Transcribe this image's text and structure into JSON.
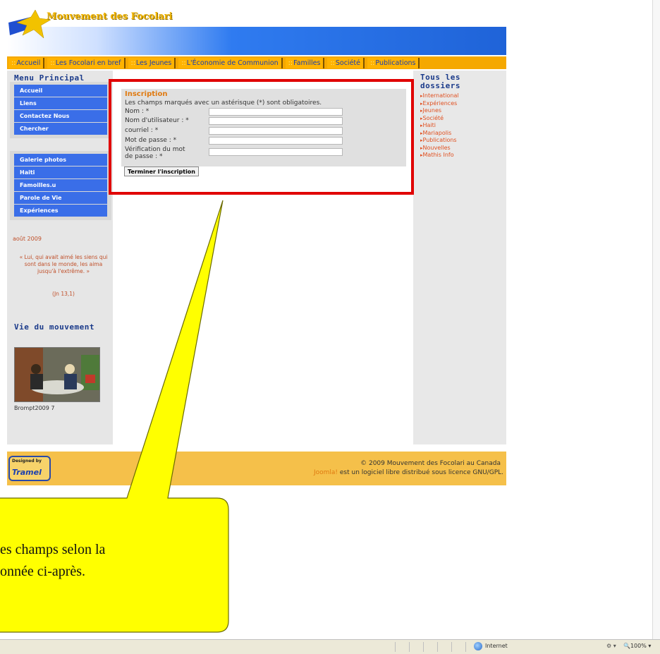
{
  "header": {
    "site_title": "Mouvement des Focolari"
  },
  "nav": [
    "Accueil",
    "Les Focolari en bref",
    "Les Jeunes",
    "L'Économie de Communion",
    "Familles",
    "Société",
    "Publications"
  ],
  "left": {
    "menu_title": "Menu Principal",
    "menu1": [
      "Accueil",
      "Liens",
      "Contactez Nous",
      "Chercher"
    ],
    "menu2": [
      "Galerie photos",
      "Haiti",
      "Famoilles.u",
      "Parole de Vie",
      "Expériences"
    ],
    "date": "août 2009",
    "quote": "« Lui, qui avait aimé les siens qui sont dans le monde, les aima jusqu'à l'extrême. »",
    "quote_ref": "(Jn 13,1)",
    "vie_title": "Vie du mouvement",
    "photo_caption": "Brompt2009 7"
  },
  "form": {
    "title": "Inscription",
    "note": "Les champs marqués avec un astérisque (*) sont obligatoires.",
    "labels": [
      "Nom : *",
      "Nom d'utilisateur : *",
      "courriel : *",
      "Mot de passe : *",
      "Vérification du mot",
      "de passe : *"
    ],
    "submit": "Terminer l'inscription"
  },
  "right": {
    "title": "Tous les dossiers",
    "items": [
      "International",
      "Expériences",
      "Jeunes",
      "Société",
      "Haiti",
      "Mariapolis",
      "Publications",
      "Nouvelles",
      "Mathis Info"
    ]
  },
  "footer": {
    "line1": "© 2009 Mouvement des Focolari au Canada",
    "joomla": "Joomla!",
    "line2": "est un logiciel libre distribué sous licence GNU/GPL.",
    "badge_small": "Designed by",
    "badge_big": "Tramel"
  },
  "callout": {
    "line1": "es champs selon la",
    "line2": "onnée ci-après."
  },
  "statusbar": {
    "zone": "Internet",
    "zoom": "100%"
  },
  "colors": {
    "highlight": "#e00000",
    "callout": "#ffff00",
    "nav": "#f5a800",
    "footer": "#f5c04a",
    "menu": "#3a6ee8"
  }
}
